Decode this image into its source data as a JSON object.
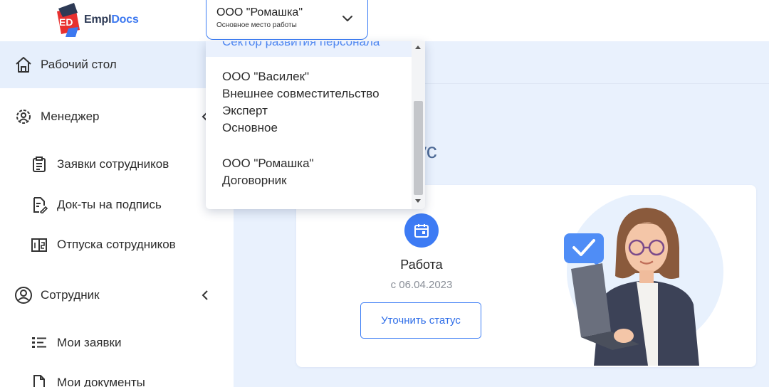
{
  "app": {
    "logo_badge": "ED",
    "logo_text_dark": "Empl",
    "logo_text_accent": "Docs",
    "colors": {
      "brand_red": "#e8302f",
      "brand_dark": "#2d3a55",
      "accent": "#3c78f0"
    }
  },
  "org_select": {
    "value": "ООО \"Ромашка\"",
    "subtitle": "Основное место работы",
    "icon": "chevron-down-icon"
  },
  "dropdown": {
    "partial_top": "Сектор развития персонала",
    "options": [
      {
        "lines": [
          "ООО \"Василек\"",
          "Внешнее совместительство",
          "Эксперт",
          "Основное"
        ]
      },
      {
        "lines": [
          "ООО \"Ромашка\"",
          "Договорник"
        ]
      }
    ]
  },
  "sidebar": {
    "items": [
      {
        "label": "Рабочий стол",
        "icon": "home-icon",
        "active": true
      },
      {
        "label": "Менеджер",
        "icon": "manager-gear-icon",
        "chevron": "chevron-left-icon"
      },
      {
        "label": "Заявки сотрудников",
        "icon": "clipboard-icon"
      },
      {
        "label": "Док-ты на подпись",
        "icon": "document-sign-icon"
      },
      {
        "label": "Отпуска сотрудников",
        "icon": "vacation-calendar-icon"
      },
      {
        "label": "Сотрудник",
        "icon": "user-circle-icon",
        "chevron": "chevron-left-icon"
      },
      {
        "label": "Мои заявки",
        "icon": "list-icon"
      },
      {
        "label": "Мои документы",
        "icon": "document-icon"
      }
    ]
  },
  "main": {
    "status_title_visible": "атус",
    "status_card": {
      "icon": "calendar-icon",
      "status": "Работа",
      "since": "с 06.04.2023",
      "button_label": "Уточнить статус",
      "illustration": "woman-with-laptop-illustration"
    }
  }
}
